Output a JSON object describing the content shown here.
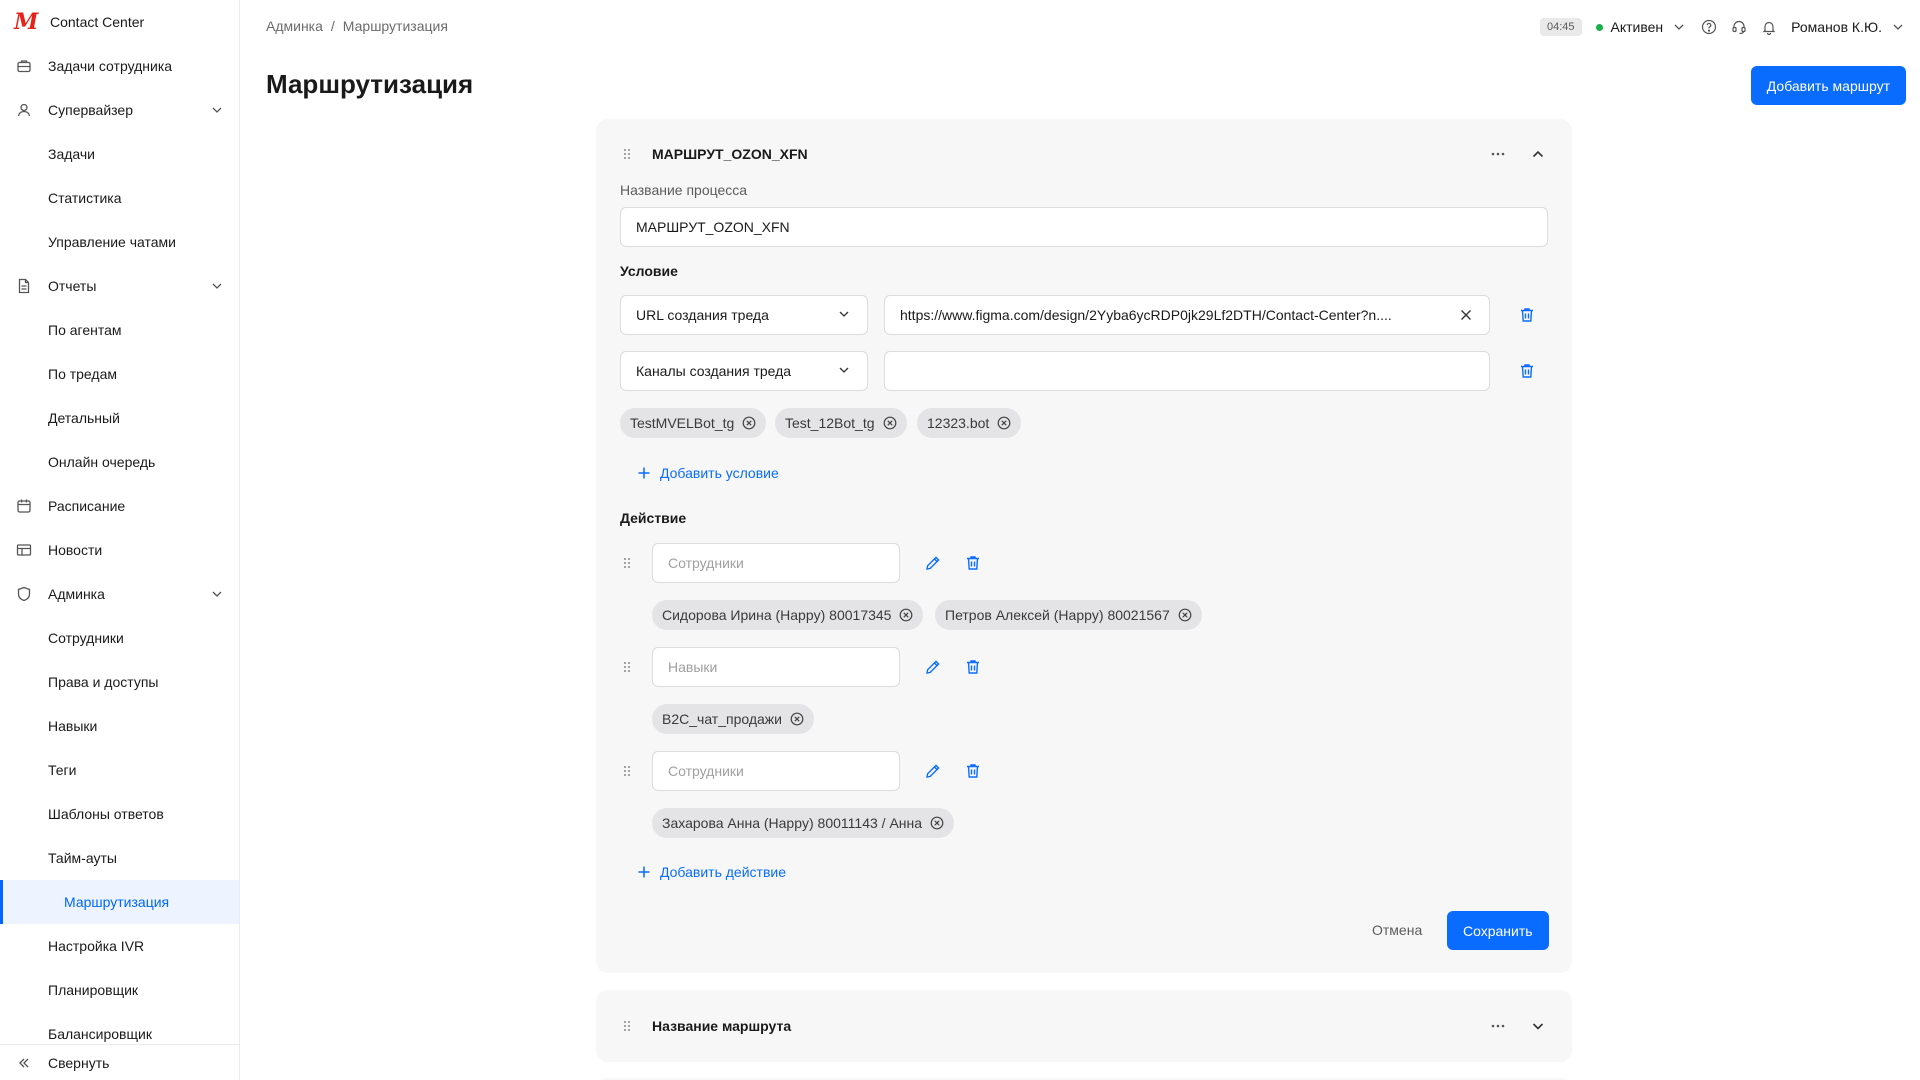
{
  "app": {
    "name": "Contact Center"
  },
  "sidebar": {
    "items": [
      {
        "label": "Задачи сотрудника"
      },
      {
        "label": "Супервайзер"
      },
      {
        "label": "Задачи"
      },
      {
        "label": "Статистика"
      },
      {
        "label": "Управление чатами"
      },
      {
        "label": "Отчеты"
      },
      {
        "label": "По агентам"
      },
      {
        "label": "По тредам"
      },
      {
        "label": "Детальный"
      },
      {
        "label": "Онлайн очередь"
      },
      {
        "label": "Расписание"
      },
      {
        "label": "Новости"
      },
      {
        "label": "Админка"
      },
      {
        "label": "Сотрудники"
      },
      {
        "label": "Права и доступы"
      },
      {
        "label": "Навыки"
      },
      {
        "label": "Теги"
      },
      {
        "label": "Шаблоны ответов"
      },
      {
        "label": "Тайм-ауты"
      },
      {
        "label": "Маршрутизация"
      },
      {
        "label": "Настройка IVR"
      },
      {
        "label": "Планировщик"
      },
      {
        "label": "Балансировщик"
      }
    ],
    "collapse_label": "Свернуть"
  },
  "breadcrumb": {
    "parent": "Админка",
    "separator": "/",
    "current": "Маршрутизация"
  },
  "topbar": {
    "timer": "04:45",
    "status": "Активен",
    "status_color": "#17b04b",
    "user": "Романов К.Ю."
  },
  "page": {
    "title": "Маршрутизация",
    "add_button": "Добавить маршрут"
  },
  "route": {
    "title": "МАРШРУТ_OZON_XFN",
    "process_label": "Название процесса",
    "process_value": "МАРШРУТ_OZON_XFN",
    "condition_label": "Условие",
    "conditions": [
      {
        "type": "URL создания треда",
        "value": "https://www.figma.com/design/2Yyba6ycRDP0jk29Lf2DTH/Contact-Center?n...."
      },
      {
        "type": "Каналы создания треда",
        "value": ""
      }
    ],
    "channel_chips": [
      "TestMVELBot_tg",
      "Test_12Bot_tg",
      "12323.bot"
    ],
    "add_condition": "Добавить условие",
    "action_label": "Действие",
    "actions": [
      {
        "placeholder": "Сотрудники",
        "chips": [
          "Сидорова Ирина (Happy) 80017345",
          "Петров Алексей (Happy) 80021567"
        ]
      },
      {
        "placeholder": "Навыки",
        "chips": [
          "B2C_чат_продажи"
        ]
      },
      {
        "placeholder": "Сотрудники",
        "chips": [
          "Захарова Анна (Happy) 80011143 /  Анна"
        ]
      }
    ],
    "add_action": "Добавить действие",
    "cancel": "Отмена",
    "save": "Сохранить"
  },
  "route2": {
    "title": "Название маршрута"
  },
  "colors": {
    "accent": "#0a6cff",
    "logo": "#e3241b"
  }
}
